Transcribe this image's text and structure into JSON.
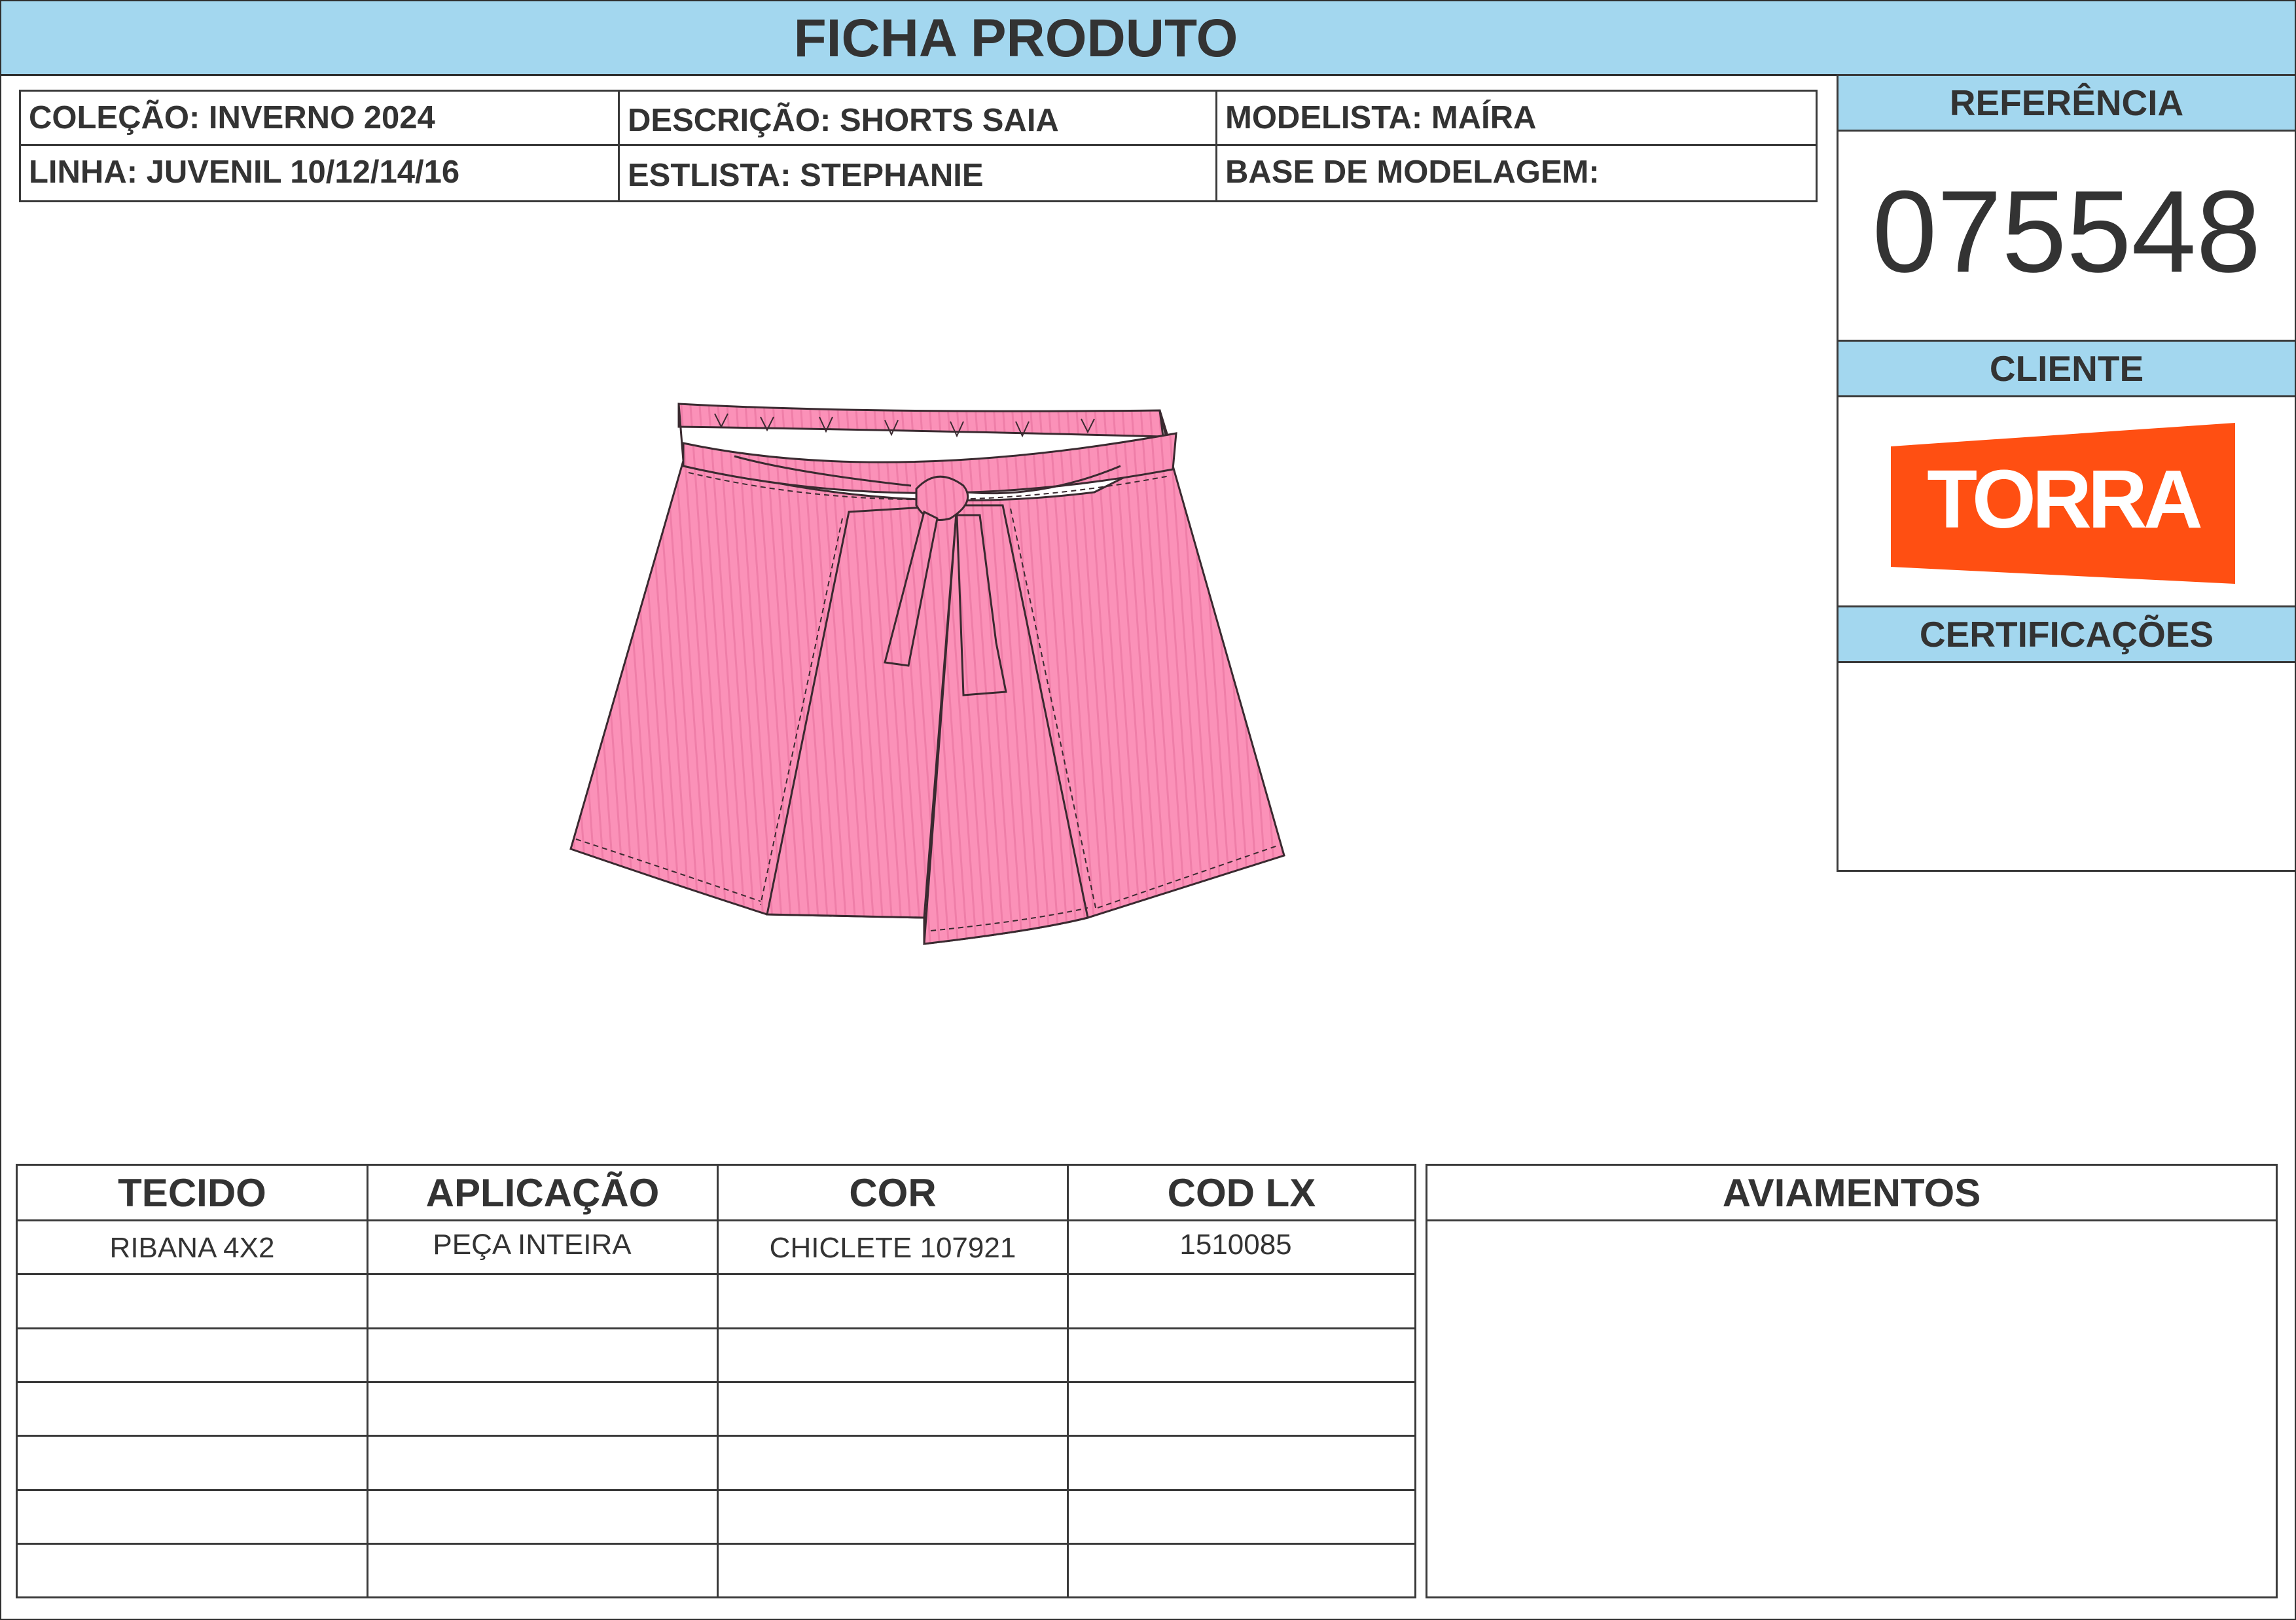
{
  "header": {
    "title": "FICHA PRODUTO"
  },
  "info": {
    "colecao": "COLEÇÃO: INVERNO 2024",
    "descricao": "DESCRIÇÃO: SHORTS SAIA",
    "modelista": "MODELISTA: MAÍRA",
    "linha": "LINHA: JUVENIL 10/12/14/16",
    "estilista": "ESTLISTA: STEPHANIE",
    "base": "BASE DE MODELAGEM:"
  },
  "panel": {
    "referencia_label": "REFERÊNCIA",
    "referencia_value": "075548",
    "cliente_label": "CLIENTE",
    "cliente_logo_text": "TORRA",
    "certificacoes_label": "CERTIFICAÇÕES"
  },
  "materials": {
    "headers": [
      "TECIDO",
      "APLICAÇÃO",
      "COR",
      "COD LX"
    ],
    "rows": [
      [
        "RIBANA 4X2",
        "PEÇA INTEIRA",
        "CHICLETE 107921",
        "1510085"
      ]
    ]
  },
  "aviamentos": {
    "label": "AVIAMENTOS"
  },
  "colors": {
    "header_blue": "#a3d7ef",
    "garment_pink": "#fb91b8",
    "logo_orange": "#ff4f12"
  },
  "icons": {
    "garment": "shorts-saia-illustration",
    "logo": "torra-logo"
  }
}
